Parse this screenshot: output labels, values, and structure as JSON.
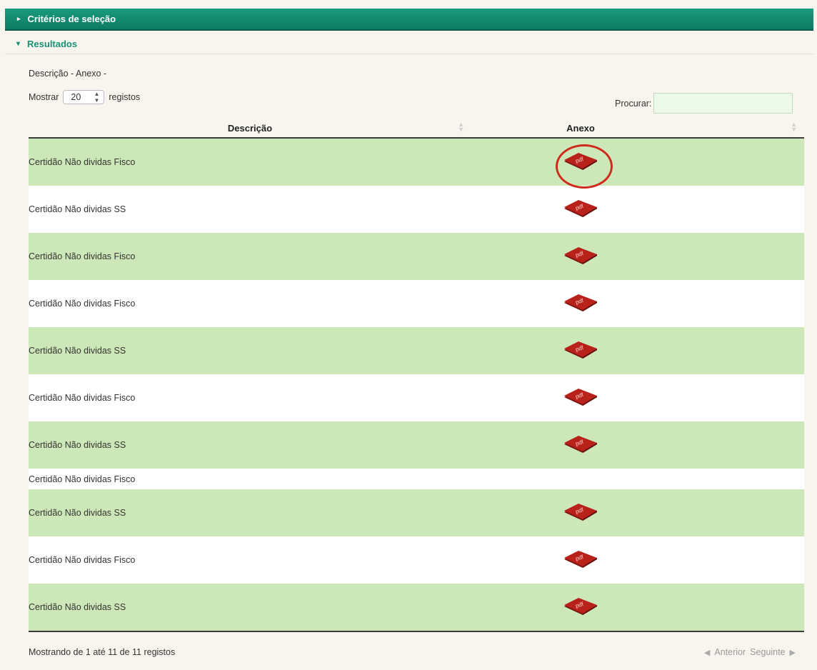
{
  "criteria_bar": {
    "label": "Critérios de seleção"
  },
  "results_bar": {
    "label": "Resultados"
  },
  "breadcrumb": "Descrição - Anexo -",
  "length": {
    "prefix": "Mostrar",
    "value": "20",
    "suffix": "registos"
  },
  "search": {
    "label": "Procurar:",
    "value": ""
  },
  "columns": [
    "Descrição",
    "Anexo"
  ],
  "rows": [
    {
      "descricao": "Certidão Não dividas Fisco",
      "anexo": "pdf",
      "highlighted": true
    },
    {
      "descricao": "Certidão Não dividas SS",
      "anexo": "pdf"
    },
    {
      "descricao": "Certidão Não dividas Fisco",
      "anexo": "pdf"
    },
    {
      "descricao": "Certidão Não dividas Fisco",
      "anexo": "pdf"
    },
    {
      "descricao": "Certidão Não dividas SS",
      "anexo": "pdf"
    },
    {
      "descricao": "Certidão Não dividas Fisco",
      "anexo": "pdf"
    },
    {
      "descricao": "Certidão Não dividas SS",
      "anexo": "pdf"
    },
    {
      "descricao": "Certidão Não dividas Fisco",
      "anexo": ""
    },
    {
      "descricao": "Certidão Não dividas SS",
      "anexo": "pdf"
    },
    {
      "descricao": "Certidão Não dividas Fisco",
      "anexo": "pdf"
    },
    {
      "descricao": "Certidão Não dividas SS",
      "anexo": "pdf"
    }
  ],
  "pdf_icon_text": "pdf",
  "footer": {
    "info": "Mostrando de 1 até 11 de 11 registos",
    "prev": "Anterior",
    "next": "Seguinte"
  },
  "colors": {
    "header": "#0d7a63",
    "row_green": "#cde8b8",
    "pdf_red": "#b8221a",
    "highlight": "#cf2b1d"
  }
}
